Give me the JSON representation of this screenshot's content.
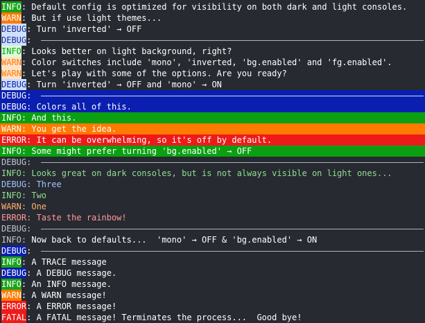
{
  "palette": {
    "bg": "#272a31",
    "white": "#ffffff",
    "info_bg": "#1aa51a",
    "warn_bg": "#ff7a00",
    "debug_bg": "#cfe0ff",
    "debug_fg": "#1b2a8c",
    "error_bg": "#ee1a1a",
    "fatal_bg": "#ee1a1a",
    "trace_bg": "#1aa51a",
    "navy": "#0a1fb0",
    "green": "#0aa012",
    "orange": "#ff7a00",
    "red": "#ff1a1a",
    "muted": "#bfc5cf",
    "rule": "#c8ccd4",
    "info_fg_plain": "#8fe08f",
    "warn_fg_plain": "#ffb26b",
    "debug_fg_plain": "#9fc6ff",
    "error_fg_plain": "#ff9a9a"
  },
  "lines": [
    {
      "level": "INFO",
      "style": "badge",
      "bg": "#1aa51a",
      "fg": "#ffffff",
      "sep": ": ",
      "text": "Default config is optimized for visibility on both dark and light consoles.",
      "text_fg": "#ffffff"
    },
    {
      "level": "WARN",
      "style": "badge",
      "bg": "#ff7a00",
      "fg": "#ffffff",
      "sep": ": ",
      "text": "But if use light themes...",
      "text_fg": "#ffffff"
    },
    {
      "level": "DEBUG",
      "style": "badge",
      "bg": "#cfe0ff",
      "fg": "#1b2a8c",
      "sep": ": ",
      "text": "Turn 'inverted' → OFF",
      "text_fg": "#ffffff"
    },
    {
      "level": "DEBUG",
      "style": "badge-rule",
      "bg": "#cfe0ff",
      "fg": "#1b2a8c",
      "sep": ": ",
      "text": "",
      "text_fg": "#c8ccd4"
    },
    {
      "level": "INFO",
      "style": "badge-inv",
      "bg": "#d6ffd6",
      "fg": "#0aa012",
      "sep": ": ",
      "text": "Looks better on light background, right?",
      "text_fg": "#ffffff"
    },
    {
      "level": "WARN",
      "style": "badge-inv",
      "bg": "#ffe3c8",
      "fg": "#ff7a00",
      "sep": ": ",
      "text": "Color switches include 'mono', 'inverted, 'bg.enabled' and 'fg.enabled'.",
      "text_fg": "#ffffff"
    },
    {
      "level": "WARN",
      "style": "badge-inv",
      "bg": "#ffe3c8",
      "fg": "#ff7a00",
      "sep": ": ",
      "text": "Let's play with some of the options. Are you ready?",
      "text_fg": "#ffffff"
    },
    {
      "level": "DEBUG",
      "style": "badge-inv",
      "bg": "#cfe0ff",
      "fg": "#0a1fb0",
      "sep": ": ",
      "text": "Turn 'inverted' → OFF and 'mono' → ON",
      "text_fg": "#ffffff"
    },
    {
      "level": "DEBUG",
      "style": "full-rule",
      "bg": "#0a1fb0",
      "fg": "#ffffff",
      "sep": ": ",
      "text": "",
      "text_fg": "#ffffff"
    },
    {
      "level": "DEBUG",
      "style": "full",
      "bg": "#0a1fb0",
      "fg": "#ffffff",
      "sep": ": ",
      "text": "Colors all of this.",
      "text_fg": "#ffffff"
    },
    {
      "level": "INFO",
      "style": "full",
      "bg": "#0aa012",
      "fg": "#ffffff",
      "sep": ": ",
      "text": "And this.",
      "text_fg": "#ffffff"
    },
    {
      "level": "WARN",
      "style": "full",
      "bg": "#ff7a00",
      "fg": "#ffffff",
      "sep": ": ",
      "text": "You get the idea.",
      "text_fg": "#ffffff"
    },
    {
      "level": "ERROR",
      "style": "full",
      "bg": "#ee1a1a",
      "fg": "#ffffff",
      "sep": ": ",
      "text": "It can be overwhelming, so it's off by default.",
      "text_fg": "#ffffff"
    },
    {
      "level": "INFO",
      "style": "full",
      "bg": "#0aa012",
      "fg": "#ffffff",
      "sep": ": ",
      "text": "Some might prefer turning 'bg.enabled' → OFF",
      "text_fg": "#ffffff"
    },
    {
      "level": "DEBUG",
      "style": "plain-rule",
      "bg": "",
      "fg": "#bfc5cf",
      "sep": ": ",
      "text": "",
      "text_fg": "#bfc5cf"
    },
    {
      "level": "INFO",
      "style": "plain",
      "bg": "",
      "fg": "#8fe08f",
      "sep": ": ",
      "text": "Looks great on dark consoles, but is not always visible on light ones...",
      "text_fg": "#8fe08f"
    },
    {
      "level": "DEBUG",
      "style": "plain",
      "bg": "",
      "fg": "#9fc6ff",
      "sep": ": ",
      "text": "Three",
      "text_fg": "#9fc6ff"
    },
    {
      "level": "INFO",
      "style": "plain",
      "bg": "",
      "fg": "#8fe08f",
      "sep": ": ",
      "text": "Two",
      "text_fg": "#8fe08f"
    },
    {
      "level": "WARN",
      "style": "plain",
      "bg": "",
      "fg": "#ffb26b",
      "sep": ": ",
      "text": "One",
      "text_fg": "#ffb26b"
    },
    {
      "level": "ERROR",
      "style": "plain",
      "bg": "",
      "fg": "#ff9a9a",
      "sep": ": ",
      "text": "Taste the rainbow!",
      "text_fg": "#ff9a9a"
    },
    {
      "level": "DEBUG",
      "style": "plain-rule",
      "bg": "",
      "fg": "#bfc5cf",
      "sep": ": ",
      "text": "",
      "text_fg": "#bfc5cf"
    },
    {
      "level": "INFO",
      "style": "plain",
      "bg": "",
      "fg": "#bfc5cf",
      "sep": ": ",
      "text": "Now back to defaults...  'mono' → OFF & 'bg.enabled' → ON",
      "text_fg": "#ffffff"
    },
    {
      "level": "DEBUG",
      "style": "badge-rule",
      "bg": "#0a1fb0",
      "fg": "#ffffff",
      "sep": ": ",
      "text": "",
      "text_fg": "#c8ccd4"
    },
    {
      "level": "INFO",
      "style": "badge",
      "bg": "#1aa51a",
      "fg": "#ffffff",
      "sep": ": ",
      "text": "A TRACE message",
      "text_fg": "#ffffff"
    },
    {
      "level": "DEBUG",
      "style": "badge",
      "bg": "#0a1fb0",
      "fg": "#ffffff",
      "sep": ": ",
      "text": "A DEBUG message.",
      "text_fg": "#ffffff"
    },
    {
      "level": "INFO",
      "style": "badge",
      "bg": "#1aa51a",
      "fg": "#ffffff",
      "sep": ": ",
      "text": "An INFO message.",
      "text_fg": "#ffffff"
    },
    {
      "level": "WARN",
      "style": "badge",
      "bg": "#ff7a00",
      "fg": "#ffffff",
      "sep": ": ",
      "text": "A WARN message!",
      "text_fg": "#ffffff"
    },
    {
      "level": "ERROR",
      "style": "badge",
      "bg": "#ee1a1a",
      "fg": "#ffffff",
      "sep": ": ",
      "text": "A ERROR message!",
      "text_fg": "#ffffff"
    },
    {
      "level": "FATAL",
      "style": "badge",
      "bg": "#ee1a1a",
      "fg": "#ffffff",
      "sep": ": ",
      "text": "A FATAL message! Terminates the process...  Good bye!",
      "text_fg": "#ffffff"
    }
  ]
}
